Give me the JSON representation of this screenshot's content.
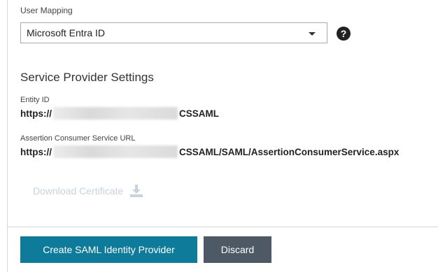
{
  "user_mapping": {
    "label": "User Mapping",
    "selected": "Microsoft Entra ID"
  },
  "help_icon": {
    "glyph": "?"
  },
  "service_provider": {
    "title": "Service Provider Settings",
    "entity_id": {
      "label": "Entity ID",
      "prefix": "https://",
      "suffix": "CSSAML"
    },
    "acs_url": {
      "label": "Assertion Consumer Service URL",
      "prefix": "https://",
      "suffix": "CSSAML/SAML/AssertionConsumerService.aspx"
    }
  },
  "download": {
    "label": "Download Certificate",
    "icon": "download-icon",
    "enabled": false
  },
  "actions": {
    "create_label": "Create SAML Identity Provider",
    "discard_label": "Discard"
  },
  "colors": {
    "primary": "#0f7b9a",
    "secondary": "#4d5a66",
    "disabled_text": "#c7d3dd"
  }
}
